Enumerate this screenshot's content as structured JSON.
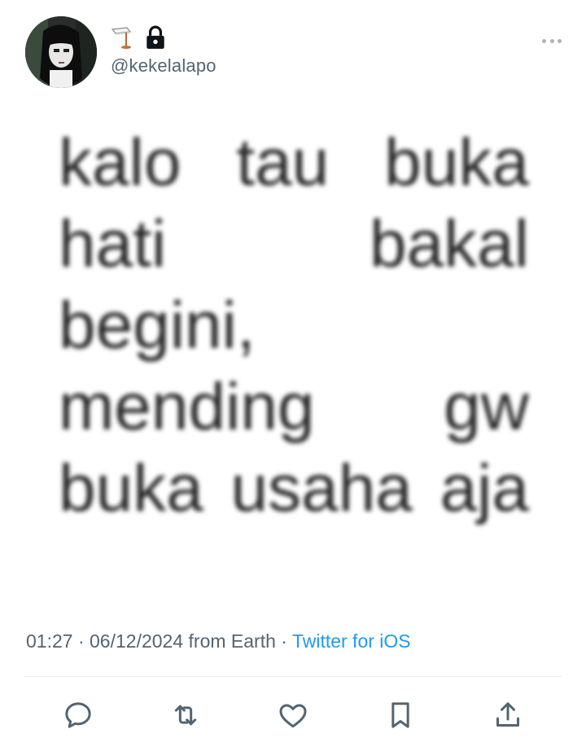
{
  "profile": {
    "handle": "@kekelalapo",
    "avatar_icon": "gothic-girl-avatar",
    "name_emoji_icon": "flag-emoji-icon",
    "protected_icon": "lock-icon"
  },
  "tweet": {
    "lines": [
      [
        "kalo",
        "tau",
        "buka"
      ],
      [
        "hati",
        "bakal"
      ],
      [
        "begini,"
      ],
      [
        "mending",
        "gw"
      ],
      [
        "buka",
        "usaha",
        "aja"
      ]
    ]
  },
  "meta": {
    "time": "01:27",
    "sep1": " · ",
    "date": "06/12/2024",
    "location": " from Earth",
    "sep2": " · ",
    "source": "Twitter for iOS"
  },
  "actions": [
    "reply-icon",
    "retweet-icon",
    "like-icon",
    "bookmark-icon",
    "share-icon"
  ],
  "colors": {
    "accent": "#1d9bf0",
    "muted": "#536471",
    "icon": "#536471"
  }
}
